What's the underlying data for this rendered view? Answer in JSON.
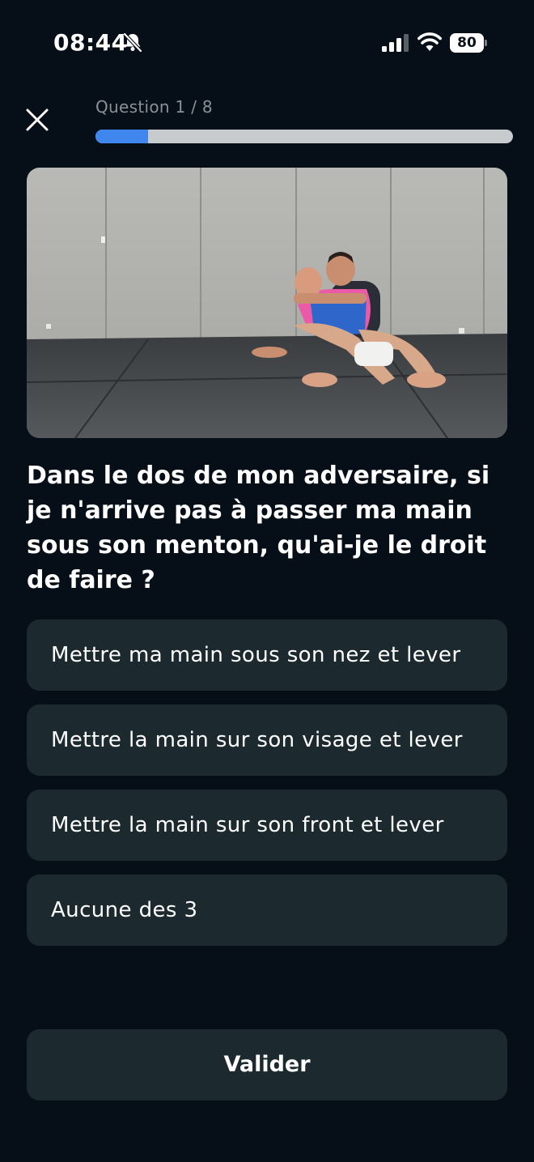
{
  "status_bar": {
    "time": "08:44",
    "battery": "80",
    "icons": [
      "bell-slash-icon",
      "cellular-signal-icon",
      "wifi-icon",
      "battery-icon"
    ]
  },
  "header": {
    "close_icon": "close-icon",
    "progress_label": "Question 1 / 8",
    "progress": {
      "current": 1,
      "total": 8
    }
  },
  "question": {
    "text": "Dans le dos de mon adversaire, si je n'arrive pas à passer ma main sous son menton, qu'ai-je le droit de faire ?"
  },
  "answers": [
    {
      "label": "Mettre ma main sous son nez et lever"
    },
    {
      "label": "Mettre la main sur son visage et lever"
    },
    {
      "label": "Mettre la main sur son front et lever"
    },
    {
      "label": "Aucune des 3"
    }
  ],
  "actions": {
    "validate_label": "Valider"
  },
  "colors": {
    "background": "#060f17",
    "card": "#1c2a30",
    "progress_fill": "#3f86ee",
    "progress_track": "#c7cbce",
    "muted_text": "#8a9298"
  }
}
